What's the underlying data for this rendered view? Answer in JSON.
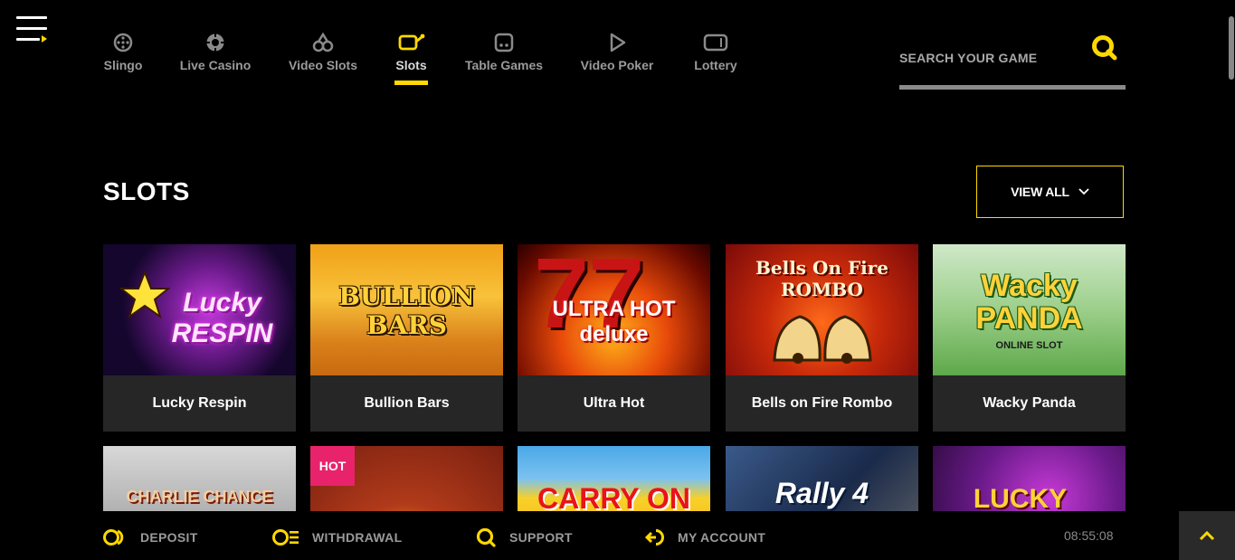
{
  "nav": {
    "items": [
      {
        "label": "Slingo",
        "icon": "slingo-icon"
      },
      {
        "label": "Live Casino",
        "icon": "live-casino-icon"
      },
      {
        "label": "Video Slots",
        "icon": "video-slots-icon"
      },
      {
        "label": "Slots",
        "icon": "slots-icon",
        "active": true
      },
      {
        "label": "Table Games",
        "icon": "table-games-icon"
      },
      {
        "label": "Video Poker",
        "icon": "video-poker-icon"
      },
      {
        "label": "Lottery",
        "icon": "lottery-icon"
      }
    ]
  },
  "search": {
    "placeholder": "SEARCH YOUR GAME",
    "value": ""
  },
  "section": {
    "title": "SLOTS",
    "view_all": "VIEW ALL"
  },
  "games": [
    {
      "name": "Lucky Respin",
      "art": "Lucky RESPIN"
    },
    {
      "name": "Bullion Bars",
      "art": "BULLION BARS"
    },
    {
      "name": "Ultra Hot",
      "art": "ULTRA HOT deluxe"
    },
    {
      "name": "Bells on Fire Rombo",
      "art": "Bells On Fire ROMBO"
    },
    {
      "name": "Wacky Panda",
      "art": "Wacky PANDA",
      "art_sub": "ONLINE SLOT"
    },
    {
      "art": "CHARLIE CHANCE"
    },
    {
      "art": "",
      "badge": "HOT"
    },
    {
      "art": "CARRY ON"
    },
    {
      "art": "Rally 4"
    },
    {
      "art": "LUCKY"
    }
  ],
  "footer": {
    "deposit": "DEPOSIT",
    "withdrawal": "WITHDRAWAL",
    "support": "SUPPORT",
    "account": "MY ACCOUNT",
    "clock": "08:55:08"
  },
  "colors": {
    "accent": "#ffd800",
    "hot": "#e8236b",
    "tile_caption_bg": "#262626"
  }
}
